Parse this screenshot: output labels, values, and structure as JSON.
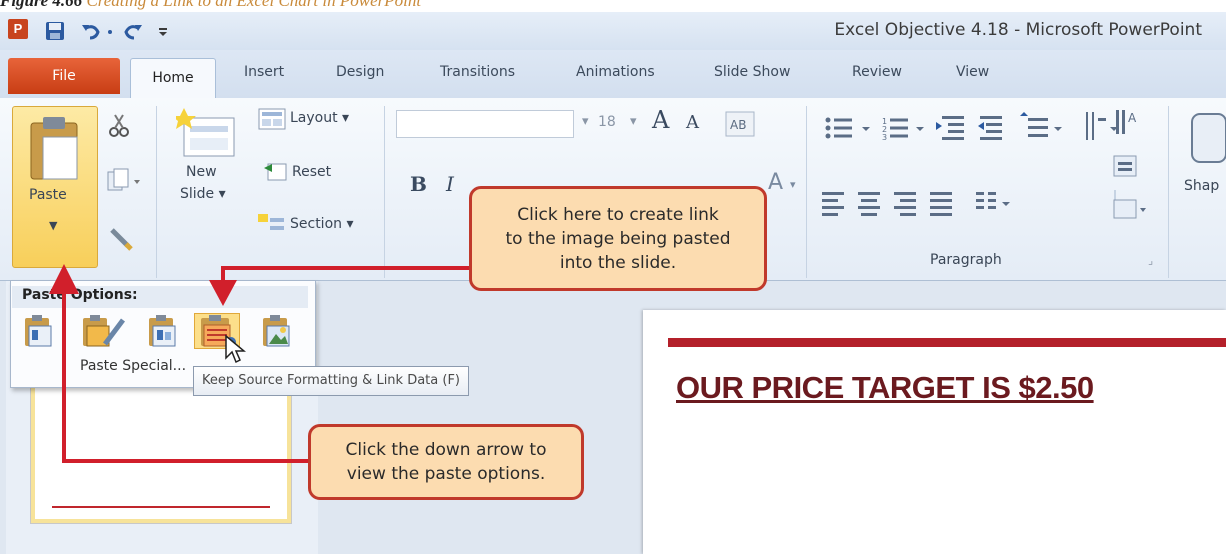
{
  "caption": {
    "figure": "Figure 4.66",
    "text": "Creating a Link to an Excel Chart in PowerPoint"
  },
  "window": {
    "title": "Excel Objective 4.18  -  Microsoft PowerPoint",
    "app_icon": "P"
  },
  "tabs": [
    "File",
    "Home",
    "Insert",
    "Design",
    "Transitions",
    "Animations",
    "Slide Show",
    "Review",
    "View"
  ],
  "ribbon": {
    "paste_label": "Paste",
    "new_slide_label_1": "New",
    "new_slide_label_2": "Slide ▾",
    "layout_label": "Layout ▾",
    "reset_label": "Reset",
    "section_label": "Section ▾",
    "font_size": "18",
    "grow_font": "A",
    "shrink_font": "A",
    "bold": "B",
    "italic": "I",
    "font_color": "A",
    "paragraph_group": "Paragraph",
    "shapes_label": "Shap"
  },
  "paste_menu": {
    "title": "Paste Options:",
    "options": [
      "use-destination-theme-icon",
      "keep-source-formatting-icon",
      "embed-workbook-icon",
      "keep-source-formatting-link-data-icon",
      "picture-icon"
    ],
    "paste_special": "Paste Special...",
    "tooltip": "Keep Source Formatting & Link Data (F)"
  },
  "slide": {
    "title": "OUR PRICE TARGET IS $2.50"
  },
  "callouts": {
    "link": {
      "line1": "Click here to create link",
      "line2": "to the image being pasted",
      "line3": "into the slide."
    },
    "arrow": {
      "line1": "Click the down arrow to",
      "line2": "view the paste options."
    }
  },
  "colors": {
    "file_tab": "#d24e23",
    "annotation_red": "#d11f2b",
    "callout_fill": "#fcdcb0",
    "slide_title": "#6b1a1f"
  }
}
